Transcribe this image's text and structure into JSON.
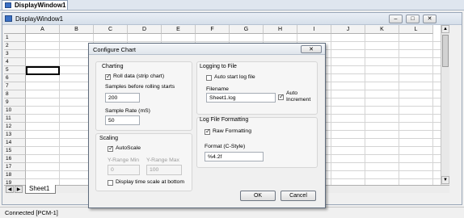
{
  "app": {
    "tab_title": "DisplayWindow1"
  },
  "window": {
    "title": "DisplayWindow1",
    "min": "‒",
    "restore": "□",
    "close": "✕"
  },
  "sheet": {
    "columns": [
      "A",
      "B",
      "C",
      "D",
      "E",
      "F",
      "G",
      "H",
      "I",
      "J",
      "K",
      "L"
    ],
    "rows": [
      "1",
      "2",
      "3",
      "4",
      "5",
      "6",
      "7",
      "8",
      "9",
      "10",
      "11",
      "12",
      "13",
      "14",
      "15",
      "16",
      "17",
      "18",
      "19"
    ],
    "tab": "Sheet1",
    "nav": [
      "◀",
      "▶"
    ]
  },
  "status": {
    "text": "Connected [PCM-1]"
  },
  "dialog": {
    "title": "Configure Chart",
    "close": "✕",
    "charting": {
      "heading": "Charting",
      "roll_label": "Roll data (strip chart)",
      "roll_checked": true,
      "samples_label": "Samples before rolling starts",
      "samples_value": "200",
      "rate_label": "Sample Rate (mS)",
      "rate_value": "50"
    },
    "scaling": {
      "heading": "Scaling",
      "autoscale_label": "AutoScale",
      "autoscale_checked": true,
      "ymin_label": "Y-Range Min",
      "ymin_value": "0",
      "ymax_label": "Y-Range Max",
      "ymax_value": "100",
      "timescale_label": "Display time scale at bottom",
      "timescale_checked": false
    },
    "logging": {
      "heading": "Logging to File",
      "autostart_label": "Auto start log file",
      "autostart_checked": false,
      "filename_label": "Filename",
      "filename_value": "Sheet1.log",
      "autoinc_label_1": "Auto",
      "autoinc_label_2": "Increment",
      "autoinc_checked": true
    },
    "formatting": {
      "heading": "Log File Formatting",
      "raw_label": "Raw Formatting",
      "raw_checked": true,
      "format_label": "Format (C-Style)",
      "format_value": "%4.2f"
    },
    "ok": "OK",
    "cancel": "Cancel"
  }
}
